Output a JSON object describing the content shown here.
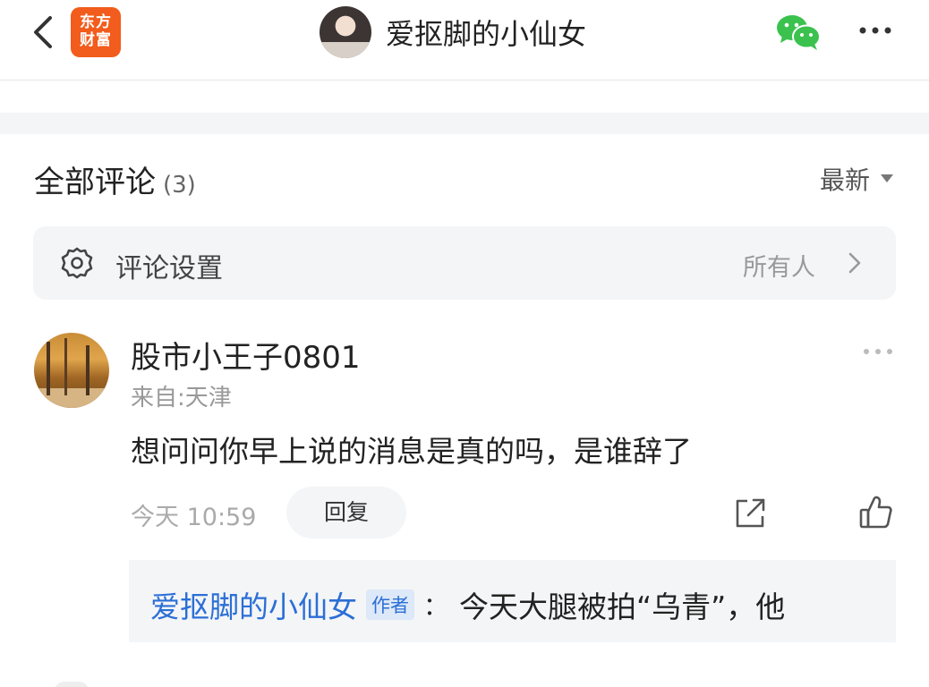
{
  "header": {
    "back_icon": "chevron-left-icon",
    "app_logo_line1": "东方",
    "app_logo_line2": "财富",
    "profile_name": "爱抠脚的小仙女",
    "share_icon": "wechat-icon",
    "more_icon": "more-horizontal-icon"
  },
  "comments": {
    "title": "全部评论",
    "count": "(3)",
    "sort_label": "最新",
    "sort_icon": "caret-down-icon"
  },
  "settings": {
    "icon": "gear-icon",
    "label": "评论设置",
    "value": "所有人",
    "chevron_icon": "chevron-right-icon"
  },
  "comment": {
    "username": "股市小王子0801",
    "location": "来自:天津",
    "text": "想问问你早上说的消息是真的吗，是谁辞了",
    "time": "今天 10:59",
    "reply_label": "回复",
    "share_icon": "share-external-icon",
    "like_icon": "thumbs-up-icon",
    "more_icon": "more-horizontal-icon",
    "reply": {
      "author": "爱抠脚的小仙女",
      "author_tag": "作者",
      "colon": "：",
      "text": "今天大腿被拍“乌青”，他"
    }
  },
  "colors": {
    "accent_blue": "#2b6fd6",
    "brand_orange": "#f25c1c",
    "wechat_green": "#3bc24e"
  }
}
